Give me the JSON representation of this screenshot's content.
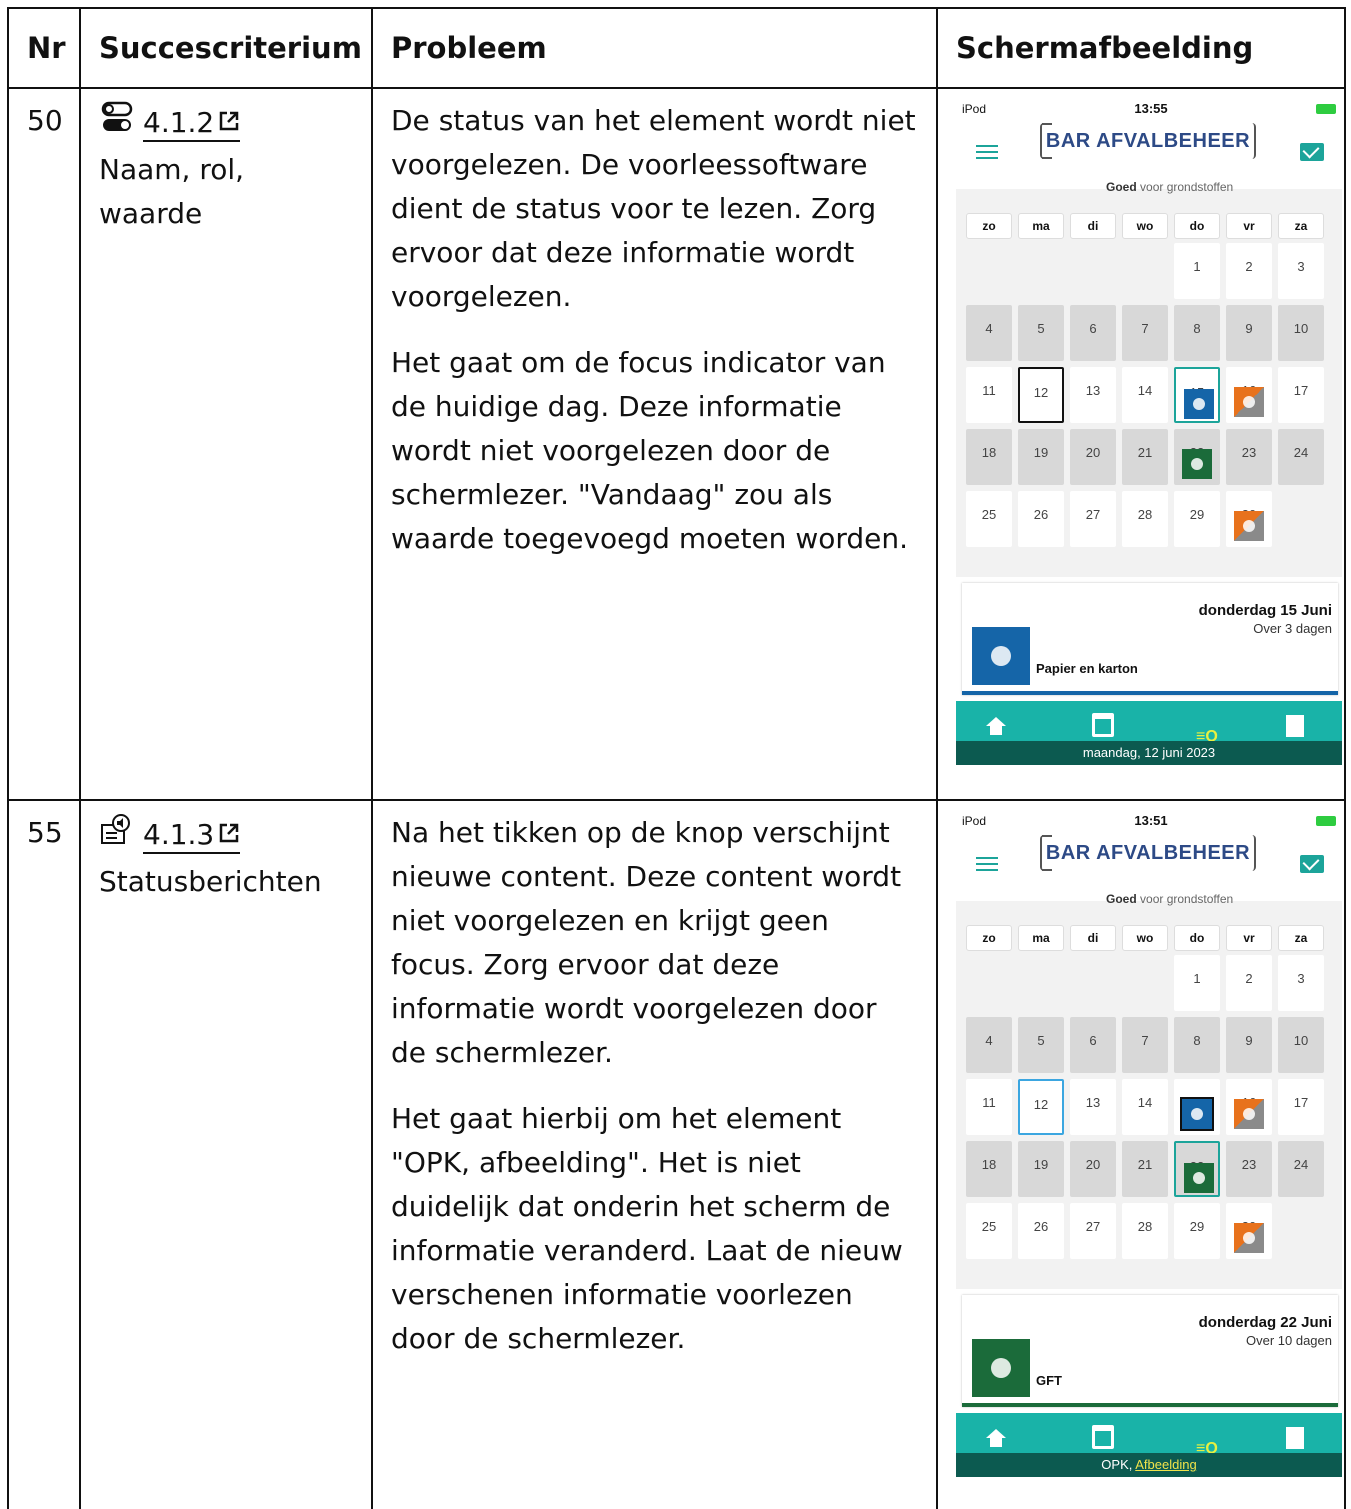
{
  "table": {
    "headers": {
      "nr": "Nr",
      "succescriterium": "Succescriterium",
      "probleem": "Probleem",
      "schermafbeelding": "Schermafbeelding"
    },
    "rows": [
      {
        "nr": "50",
        "criterion_icon": "toggle-icon",
        "criterion_code": "4.1.2",
        "criterion_name": "Naam, rol, waarde",
        "problem_p1": "De status van het element wordt niet voorgelezen. De voorleessoftware dient de status voor te lezen. Zorg ervoor dat deze informatie wordt voorgelezen.",
        "problem_p2": "Het gaat om de focus indicator van de huidige dag. Deze informatie wordt niet voorgelezen door de schermlezer. \"Vandaag\" zou als waarde toegevoegd moeten worden.",
        "screenshot": {
          "carrier": "iPod",
          "time": "13:55",
          "info_date": "donderdag 15 Juni",
          "info_rel": "Over 3 dagen",
          "info_label": "Papier en karton",
          "caption": "maandag, 12 juni 2023",
          "caption_link": ""
        }
      },
      {
        "nr": "55",
        "criterion_icon": "speaker-message-icon",
        "criterion_code": "4.1.3",
        "criterion_name": "Statusberichten",
        "problem_p1": "Na het tikken op de knop verschijnt nieuwe content. Deze content wordt niet voorgelezen en krijgt geen focus. Zorg ervoor dat deze informatie wordt voorgelezen door de schermlezer.",
        "problem_p2": "Het gaat hierbij om het element \"OPK, afbeelding\". Het is niet duidelijk dat onderin het scherm de informatie veranderd. Laat de nieuw verschenen informatie voorlezen door de schermlezer.",
        "screenshot": {
          "carrier": "iPod",
          "time": "13:51",
          "info_date": "donderdag 22 Juni",
          "info_rel": "Over 10 dagen",
          "info_label": "GFT",
          "caption": "OPK, ",
          "caption_link": "Afbeelding"
        }
      }
    ]
  },
  "app": {
    "logo_bar": "BAR",
    "logo_afval": "AFVALBEHEER",
    "tagline_strong": "Goed",
    "tagline_rest": "voor grondstoffen",
    "weekdays": [
      "zo",
      "ma",
      "di",
      "wo",
      "do",
      "vr",
      "za"
    ],
    "search_glyph": "≡Q"
  },
  "icons": {
    "external_link": "external-link-icon"
  },
  "colors": {
    "teal": "#19b3a8",
    "blue_paper": "#1565a8",
    "green_gft": "#1b6b3a",
    "orange_opk": "#e8721c"
  }
}
